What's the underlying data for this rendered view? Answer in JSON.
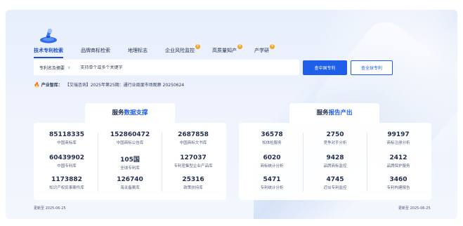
{
  "nav": {
    "tabs": [
      {
        "label": "技术专利检索",
        "active": true,
        "badge": ""
      },
      {
        "label": "品牌商标检索",
        "active": false,
        "badge": ""
      },
      {
        "label": "地理标志",
        "active": false,
        "badge": ""
      },
      {
        "label": "企业风险监控",
        "active": false,
        "badge": "¥"
      },
      {
        "label": "高质量知产",
        "active": false,
        "badge": "¥"
      },
      {
        "label": "产学研",
        "active": false,
        "badge": "¥"
      }
    ]
  },
  "search": {
    "scope_label": "专利名及摘要",
    "placeholder": "支持单个或多个关键字",
    "primary_button": "查中国专利",
    "secondary_button": "查全球专利"
  },
  "ticker": {
    "label": "产业智库：",
    "text": "【艾瑞咨询】2025年第25期：通行业周度市场观察 20250624"
  },
  "left_panel": {
    "title_plain": "服务",
    "title_highlight": "数据支撑",
    "stats": [
      {
        "value": "85118335",
        "label": "中国商标库"
      },
      {
        "value": "152860472",
        "label": "中国商标公告库"
      },
      {
        "value": "2687858",
        "label": "中国商标文书库"
      },
      {
        "value": "60439902",
        "label": "中国专利库"
      },
      {
        "value": "105国",
        "label": "全球专利库"
      },
      {
        "value": "127037",
        "label": "专利密集型企业产品库"
      },
      {
        "value": "1173882",
        "label": "知识产权民事案件库"
      },
      {
        "value": "126740",
        "label": "海关备案库"
      },
      {
        "value": "25316",
        "label": "政策扶持库"
      }
    ],
    "updated": "更新至 2025-06-25"
  },
  "right_panel": {
    "title_plain": "服务",
    "title_highlight": "报告产出",
    "stats": [
      {
        "value": "36578",
        "label": "知体检服务"
      },
      {
        "value": "2750",
        "label": "竞争对手分析"
      },
      {
        "value": "99197",
        "label": "商标注册分析"
      },
      {
        "value": "6020",
        "label": "商标统计分析"
      },
      {
        "value": "9428",
        "label": "品牌商标监控"
      },
      {
        "value": "2412",
        "label": "品牌保护服务"
      },
      {
        "value": "5471",
        "label": "专利统计分析"
      },
      {
        "value": "4745",
        "label": "近似专利监控"
      },
      {
        "value": "3460",
        "label": "专利构建报告"
      }
    ],
    "updated": "更新至 2025-06-25"
  },
  "colors": {
    "accent": "#1f5ee8",
    "badge": "#f4a62a",
    "fire": "#f05a28"
  }
}
